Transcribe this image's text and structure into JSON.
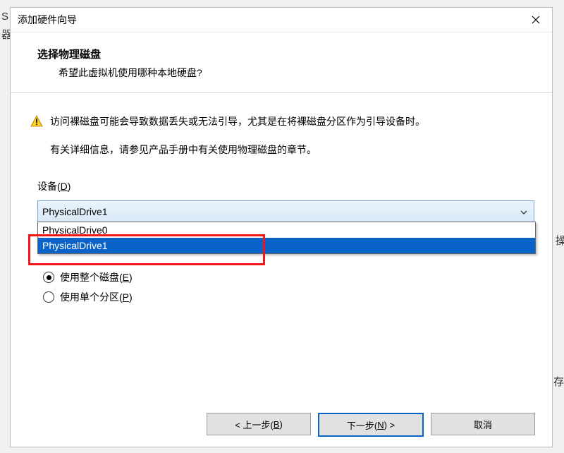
{
  "dialog": {
    "title": "添加硬件向导",
    "headerTitle": "选择物理磁盘",
    "headerSubtitle": "希望此虚拟机使用哪种本地硬盘?",
    "warningLine": "访问裸磁盘可能会导致数据丢失或无法引导，尤其是在将裸磁盘分区作为引导设备时。",
    "infoLine": "有关详细信息，请参见产品手册中有关使用物理磁盘的章节。",
    "deviceLabelPrefix": "设备(",
    "deviceLabelKey": "D",
    "deviceLabelSuffix": ")",
    "deviceSelected": "PhysicalDrive1",
    "deviceOptions": [
      "PhysicalDrive0",
      "PhysicalDrive1"
    ],
    "usage": {
      "option1_pre": "使用整个磁盘(",
      "option1_key": "E",
      "option1_suf": ")",
      "option2_pre": "使用单个分区(",
      "option2_key": "P",
      "option2_suf": ")",
      "selected": "entire"
    },
    "buttons": {
      "back_pre": "< 上一步(",
      "back_key": "B",
      "back_suf": ")",
      "next_pre": "下一步(",
      "next_key": "N",
      "next_suf": ") >",
      "cancel": "取消"
    }
  },
  "bg": {
    "s": "S",
    "qi": "器",
    "cao": "操",
    "cun": "存"
  }
}
